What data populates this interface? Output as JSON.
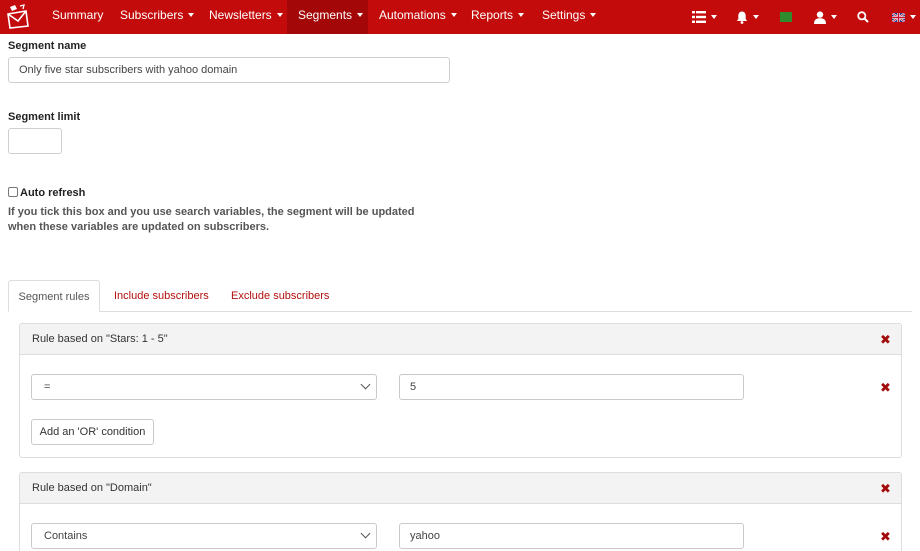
{
  "nav": {
    "items": [
      {
        "label": "Summary"
      },
      {
        "label": "Subscribers"
      },
      {
        "label": "Newsletters"
      },
      {
        "label": "Segments"
      },
      {
        "label": "Automations"
      },
      {
        "label": "Reports"
      },
      {
        "label": "Settings"
      }
    ],
    "active": "Segments",
    "right_icons": [
      "list-icon",
      "bell-icon",
      "green-flag-icon",
      "user-icon",
      "search-icon",
      "uk-flag-icon"
    ]
  },
  "form": {
    "segment_name_label": "Segment name",
    "segment_name_value": "Only five star subscribers with yahoo domain",
    "segment_limit_label": "Segment limit",
    "segment_limit_value": "",
    "auto_refresh_label": "Auto refresh",
    "auto_refresh_checked": false,
    "auto_refresh_help": "If you tick this box and you use search variables, the segment will be updated when these variables are updated on subscribers."
  },
  "tabs": [
    {
      "label": "Segment rules",
      "active": true
    },
    {
      "label": "Include subscribers",
      "active": false
    },
    {
      "label": "Exclude subscribers",
      "active": false
    }
  ],
  "rules": [
    {
      "title": "Rule based on \"Stars: 1 - 5\"",
      "condition": {
        "operator": "=",
        "value": "5"
      },
      "add_or_label": "Add an 'OR' condition"
    },
    {
      "title": "Rule based on \"Domain\"",
      "condition": {
        "operator": "Contains",
        "value": "yahoo"
      }
    }
  ],
  "colors": {
    "navbar": "#c30b0b",
    "navbar_active": "#a30707",
    "link": "#b30e0e",
    "delete_icon": "#a30b0b"
  }
}
